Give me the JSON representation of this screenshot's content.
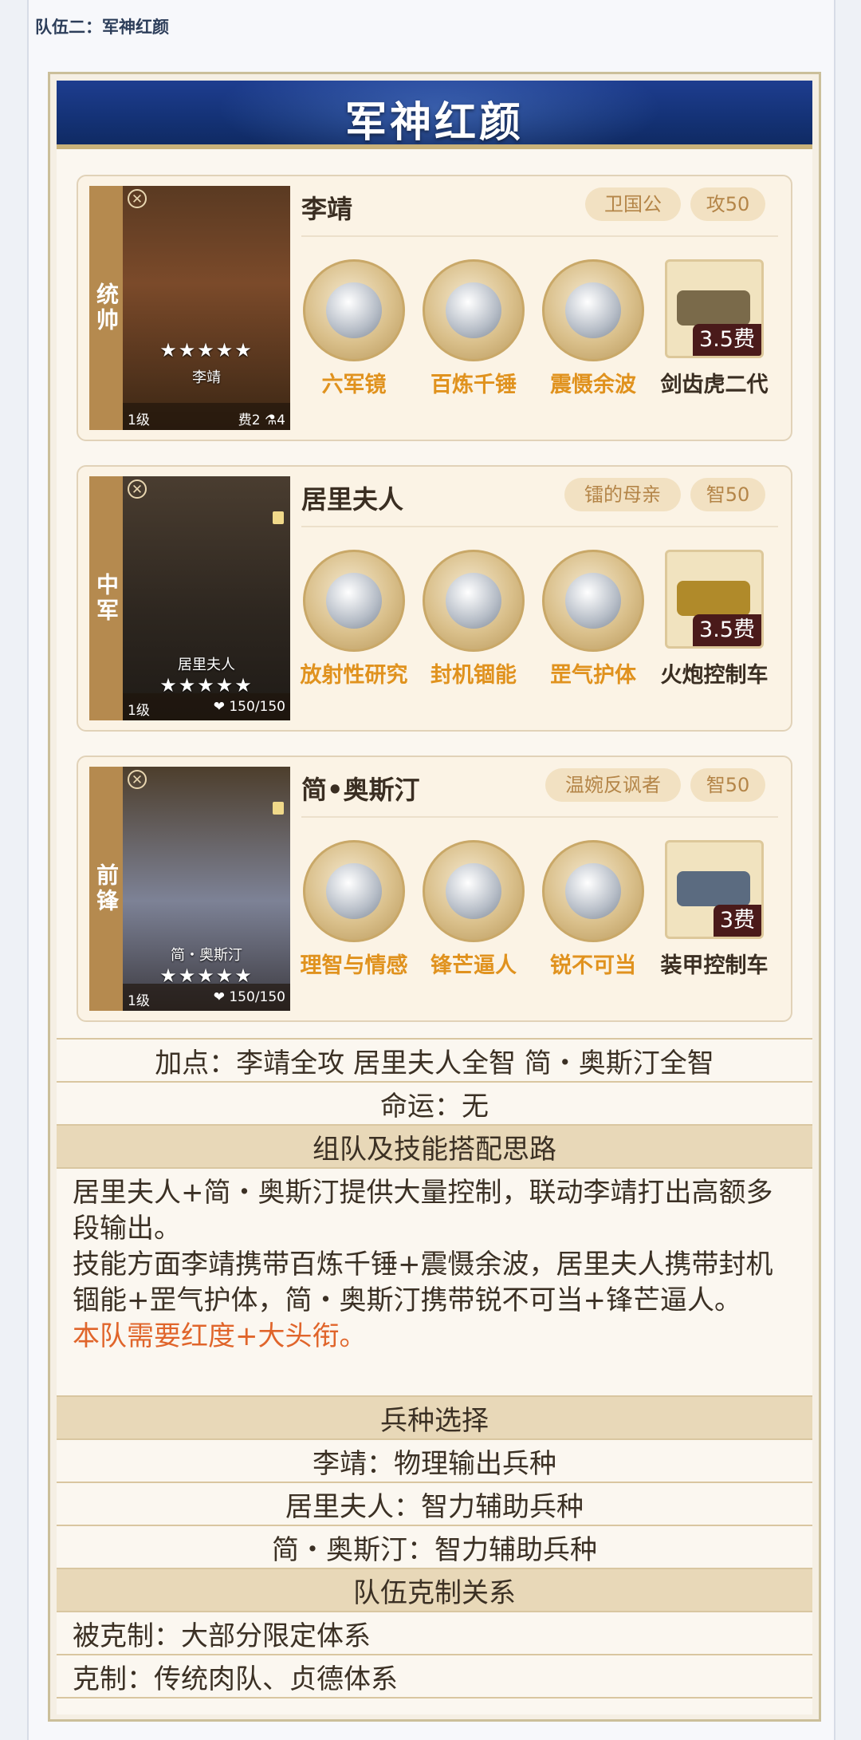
{
  "section_title": "队伍二：军神红颜",
  "banner_title": "军神红颜",
  "generals": [
    {
      "role": "统帅",
      "name": "李靖",
      "portrait_name": "李靖",
      "stars": "★★★★★",
      "level": "1级",
      "stat": "费2 ⚗4",
      "tags": [
        "卫国公",
        "攻50"
      ],
      "skills": [
        "六军镜",
        "百炼千锤",
        "震慑余波"
      ],
      "unit": {
        "name": "剑齿虎二代",
        "cost": "3.5费"
      }
    },
    {
      "role": "中军",
      "name": "居里夫人",
      "portrait_name": "居里夫人",
      "stars": "★★★★★",
      "level": "1级",
      "stat": "❤ 150/150",
      "tags": [
        "镭的母亲",
        "智50"
      ],
      "skills": [
        "放射性研究",
        "封机锢能",
        "罡气护体"
      ],
      "unit": {
        "name": "火炮控制车",
        "cost": "3.5费"
      }
    },
    {
      "role": "前锋",
      "name": "简•奥斯汀",
      "portrait_name": "简・奥斯汀",
      "stars": "★★★★★",
      "level": "1级",
      "stat": "❤ 150/150",
      "tags": [
        "温婉反讽者",
        "智50"
      ],
      "skills": [
        "理智与情感",
        "锋芒逼人",
        "锐不可当"
      ],
      "unit": {
        "name": "装甲控制车",
        "cost": "3费"
      }
    }
  ],
  "table": {
    "points": "加点：李靖全攻  居里夫人全智  简・奥斯汀全智",
    "fate": "命运：无",
    "strategy_header": "组队及技能搭配思路",
    "strategy_p1": "居里夫人+简・奥斯汀提供大量控制，联动李靖打出高额多段输出。",
    "strategy_p2": "技能方面李靖携带百炼千锤+震慑余波，居里夫人携带封机锢能+罡气护体，简・奥斯汀携带锐不可当+锋芒逼人。",
    "strategy_note": "本队需要红度+大头衔。",
    "troop_header": "兵种选择",
    "troops": [
      "李靖：物理输出兵种",
      "居里夫人：智力辅助兵种",
      "简・奥斯汀：智力辅助兵种"
    ],
    "counter_header": "队伍克制关系",
    "countered_by": "被克制：大部分限定体系",
    "counters": "克制：传统肉队、贞德体系"
  },
  "colors": {
    "banner": "#143276",
    "role_tab": "#b58a4f",
    "skill_text": "#e0921e",
    "highlight": "#e0652b"
  }
}
